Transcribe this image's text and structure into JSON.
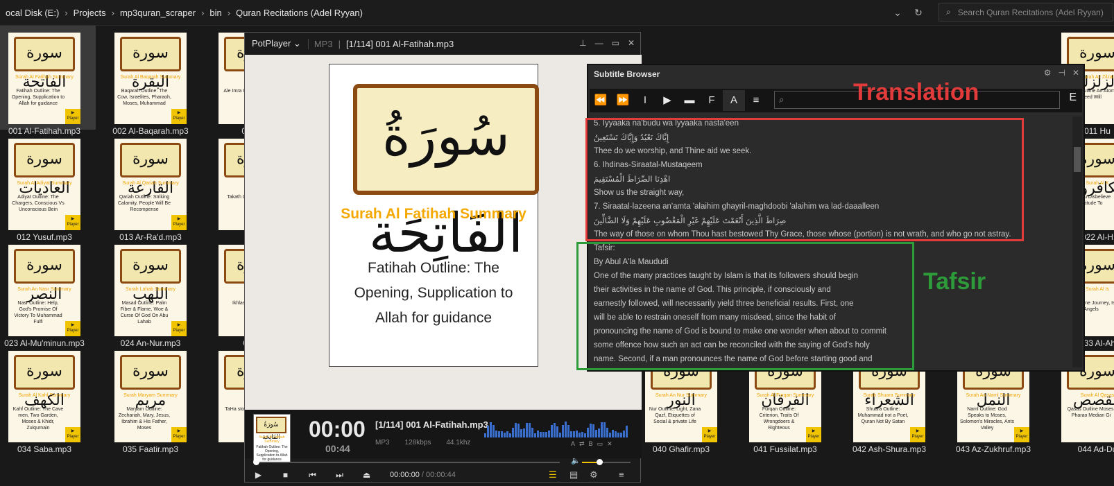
{
  "address_bar": {
    "crumbs": [
      "ocal Disk (E:)",
      "Projects",
      "mp3quran_scraper",
      "bin",
      "Quran Recitations (Adel Ryyan)"
    ],
    "search_placeholder": "Search Quran Recitations (Adel Ryyan)"
  },
  "files": [
    {
      "name": "001 Al-Fatihah.mp3",
      "arabic": "سورة الفاتحة",
      "surah": "Surah Al Fatihah Summary",
      "outline": "Fatihah Outline: The Opening, Supplication to Allah for guidance",
      "selected": true
    },
    {
      "name": "002 Al-Baqarah.mp3",
      "arabic": "سورة البقرة",
      "surah": "Surah Al Baqarah Summary",
      "outline": "Baqarah Outline: The Cow, Israelites, Pharaoh, Moses, Muhammad"
    },
    {
      "name": "003 Aa",
      "arabic": "سورة",
      "surah": "",
      "outline": "Ale Imra Chose A Of Ib"
    },
    {
      "name": "012 Yusuf.mp3",
      "arabic": "سورة العاديات",
      "surah": "Surah Al Adiyat Summary",
      "outline": "Adiyat Outline: The Chargers, Conscious Vs Unconscious Bein"
    },
    {
      "name": "013 Ar-Ra'd.mp3",
      "arabic": "سورة القارعة",
      "surah": "Surah Al Qariah Summary",
      "outline": "Qariah Outline: Striking Calamity, People Will Be Recompense"
    },
    {
      "name": "014 Il",
      "arabic": "سورة",
      "surah": "",
      "outline": "Takath Comp Forge"
    },
    {
      "name": "023 Al-Mu'minun.mp3",
      "arabic": "سورة النصر",
      "surah": "Surah An Nasr Summary",
      "outline": "Nasr Outline: Help, God's Promise Of Victory To Muhammad Fulfi"
    },
    {
      "name": "024 An-Nur.mp3",
      "arabic": "سورة اللهب",
      "surah": "Surah Lahab Summary",
      "outline": "Masad Outline: Palm Fiber & Flame, Woe & Curse Of God On Abu Lahab"
    },
    {
      "name": "025 Al",
      "arabic": "سورة",
      "surah": "Surah Al",
      "outline": "Ikhlas Pure Re"
    },
    {
      "name": "034 Saba.mp3",
      "arabic": "سورة الكهف",
      "surah": "Surah Al Kahf Summary",
      "outline": "Kahf Outline: The Cave men, Two Garden, Moses & Khidr, Zulqurnain"
    },
    {
      "name": "035 Faatir.mp3",
      "arabic": "سورة مريم",
      "surah": "Surah Maryam Summary",
      "outline": "Maryam Outline: Zechariah, Mary, Jesus, Ibrahim & His Father, Moses"
    },
    {
      "name": "036",
      "arabic": "سورة",
      "surah": "",
      "outline": "TaHa story, Ph Samin"
    },
    {
      "name": "040 Ghafir.mp3",
      "arabic": "سورة النور",
      "surah": "Surah An Nur Summary",
      "outline": "Nur Outline: Light, Zana Qazf, Etiquettes of Social & private Life"
    },
    {
      "name": "041 Fussilat.mp3",
      "arabic": "سورة الفرقان",
      "surah": "Surah Al Furqan Summary",
      "outline": "Furqan Outline: Criterion, Traits Of Wrongdoers & Righteous"
    },
    {
      "name": "042 Ash-Shura.mp3",
      "arabic": "سورة الشعراء",
      "surah": "Surah Shuara Summary",
      "outline": "Shuara Outline: Muhammad not a Poet, Quran Not By Satan"
    },
    {
      "name": "043 Az-Zukhruf.mp3",
      "arabic": "سورة النمل",
      "surah": "Surah An Naml Summary",
      "outline": "Naml Outline: God Speaks to Moses, Solomon's Miracles, Ants Valley"
    },
    {
      "name": "044 Ad-Du",
      "arabic": "سورة القصص",
      "surah": "Surah Al Qasas",
      "outline": "Qasas Outline Moses, Pharao Median Gi"
    },
    {
      "name": "011 Hu",
      "arabic": "سورة الزلزلة",
      "surah": "Surah Az Zilzal",
      "outline": "Zilzal Outline An Atom Deed Will"
    },
    {
      "name": "022 Al-H",
      "arabic": "سورة الكافرون",
      "surah": "Surah Al K",
      "outline": "Kafirou Disbelieve Attitude To"
    },
    {
      "name": "033 Al-Ah",
      "arabic": "سورة",
      "surah": "Surah Al Is",
      "outline": "Isra Outline Journey, Isr Angels"
    }
  ],
  "player": {
    "brand": "PotPlayer",
    "format": "MP3",
    "track": "[1/114] 001 Al-Fatihah.mp3",
    "art_arabic": "سُورَةُ الفَاتِحَة",
    "art_title": "Surah Al Fatihah Summary",
    "art_outline": "Fatihah Outline: The Opening, Supplication to Allah for guidance",
    "time_current": "00:00",
    "time_total": "00:44",
    "now_playing": "[1/114] 001 Al-Fatihah.mp3",
    "bitrate": "128kbps",
    "freq": "44.1khz",
    "position": "00:00:00",
    "duration": "/ 00:00:44",
    "seek_fraction": 0.0,
    "volume_fraction": 0.35
  },
  "subtitle_browser": {
    "title": "Subtitle Browser",
    "search": "",
    "toolbar_end": "E",
    "lines": [
      {
        "t": "5. Iyyaaka na'budu wa lyyaaka nasta'een",
        "ar": false
      },
      {
        "t": "إِيَّاكَ نَعْبُدُ وَإِيَّاكَ نَسْتَعِينُ",
        "ar": true
      },
      {
        "t": "Thee do we worship, and Thine aid we seek.",
        "ar": false
      },
      {
        "t": "6. Ihdinas-Siraatal-Mustaqeem",
        "ar": false
      },
      {
        "t": "اهْدِنَا الصِّرَاطَ الْمُسْتَقِيمَ",
        "ar": true
      },
      {
        "t": "Show us the straight way,",
        "ar": false
      },
      {
        "t": "7. Siraatal-lazeena an'amta 'alaihim ghayril-maghdoobi 'alaihim wa lad-daaalleen",
        "ar": false
      },
      {
        "t": "صِرَاطَ الَّذِينَ أَنْعَمْتَ عَلَيْهِمْ غَيْرِ الْمَغْضُوبِ عَلَيْهِمْ وَلَا الضَّالِّينَ",
        "ar": true
      },
      {
        "t": "The way of those on whom Thou hast bestowed Thy Grace, those whose (portion) is not wrath, and who go not astray.",
        "ar": false
      },
      {
        "t": "Tafsir:",
        "ar": false
      },
      {
        "t": "By Abul A'la Maududi",
        "ar": false
      },
      {
        "t": "One of the many practices taught by Islam is that its followers should begin",
        "ar": false
      },
      {
        "t": "their activities in the name of God. This principle, if consciously and",
        "ar": false
      },
      {
        "t": "earnestly followed, will necessarily yield three beneficial results. First, one",
        "ar": false
      },
      {
        "t": "will be able to restrain oneself from many misdeed, since the habit of",
        "ar": false
      },
      {
        "t": "pronouncing the name of God is bound to make one wonder when about to commit",
        "ar": false
      },
      {
        "t": "some offence how such an act can be reconciled with the saying of God's holy",
        "ar": false
      },
      {
        "t": "name. Second, if a man pronounces the name of God before starting good and",
        "ar": false
      }
    ]
  },
  "annotations": {
    "translation_label": "Translation",
    "tafsir_label": "Tafsir",
    "translation_color": "#e23b3b",
    "tafsir_color": "#2e9b3a"
  }
}
